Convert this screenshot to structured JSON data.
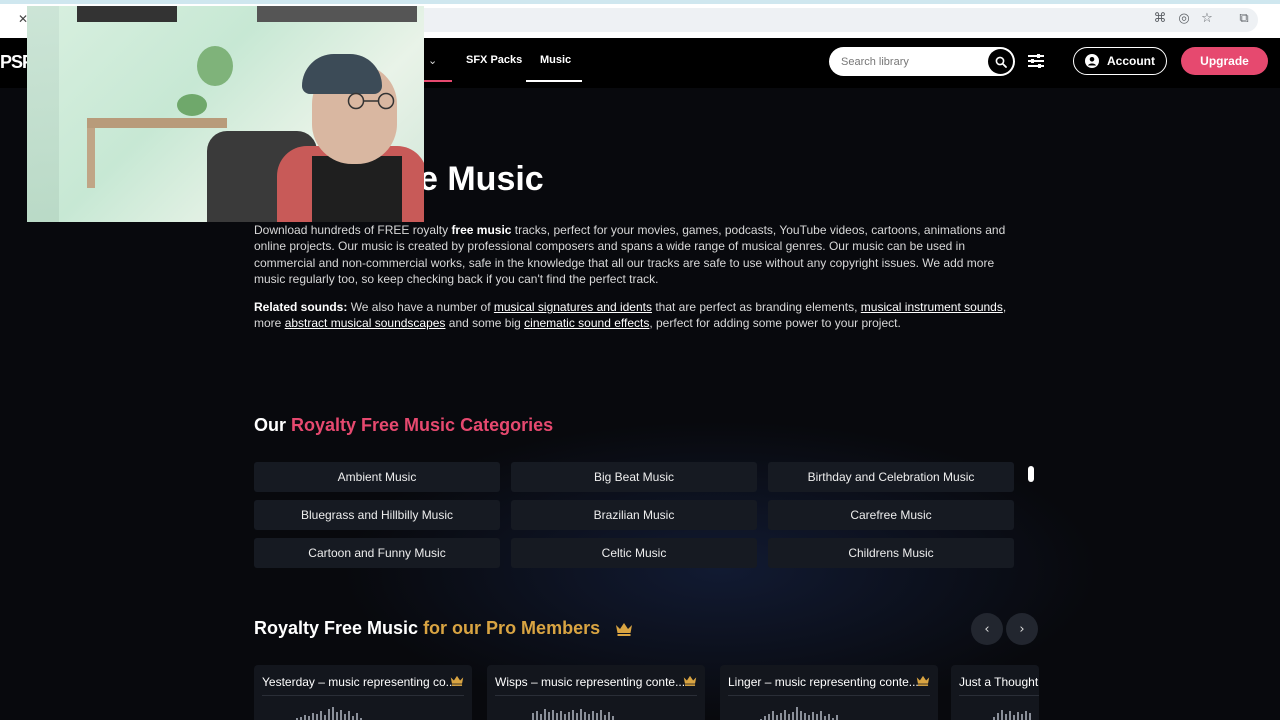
{
  "browser": {
    "tab_close": "✕"
  },
  "header": {
    "logo": "PSF",
    "nav": [
      {
        "label": "SFX Packs"
      },
      {
        "label": "Music"
      }
    ],
    "search_placeholder": "Search library",
    "account_label": "Account",
    "upgrade_label": "Upgrade"
  },
  "hero": {
    "title": "e Music",
    "para1": {
      "t1": "Download hundreds of FREE royalty ",
      "bold": "free music",
      "t2": " tracks, perfect for your movies, games, podcasts, YouTube videos, cartoons, animations and online projects. Our music is created by professional composers and spans a wide range of musical genres. Our music can be used in commercial and non-commercial works, safe in the knowledge that all our tracks are safe to use without any copyright issues. We add more music regularly too, so keep checking back if you can't find the perfect track."
    },
    "para2": {
      "label": "Related sounds:",
      "t1": " We also have a number of ",
      "link1": "musical signatures and idents",
      "t2": " that are perfect as branding elements, ",
      "link2": "musical instrument sounds",
      "t3": ", more ",
      "link3": "abstract musical soundscapes",
      "t4": " and some big ",
      "link4": "cinematic sound effects",
      "t5": ", perfect for adding some power to your project."
    }
  },
  "categories": {
    "title_white": "Our ",
    "title_pink": "Royalty Free Music Categories",
    "items": [
      "Ambient Music",
      "Big Beat Music",
      "Birthday and Celebration Music",
      "Bluegrass and Hillbilly Music",
      "Brazilian Music",
      "Carefree Music",
      "Cartoon and Funny Music",
      "Celtic Music",
      "Childrens Music"
    ]
  },
  "pro": {
    "title_white": "Royalty Free Music ",
    "title_gold": "for our Pro Members",
    "prev": "‹",
    "next": "›",
    "cards": [
      {
        "title": "Yesterday – music representing co..."
      },
      {
        "title": "Wisps – music representing conte..."
      },
      {
        "title": "Linger – music representing conte..."
      },
      {
        "title": "Just a Thought"
      }
    ]
  },
  "colors": {
    "accent_pink": "#e6496f",
    "accent_gold": "#d9a442",
    "bg": "#08090d"
  }
}
